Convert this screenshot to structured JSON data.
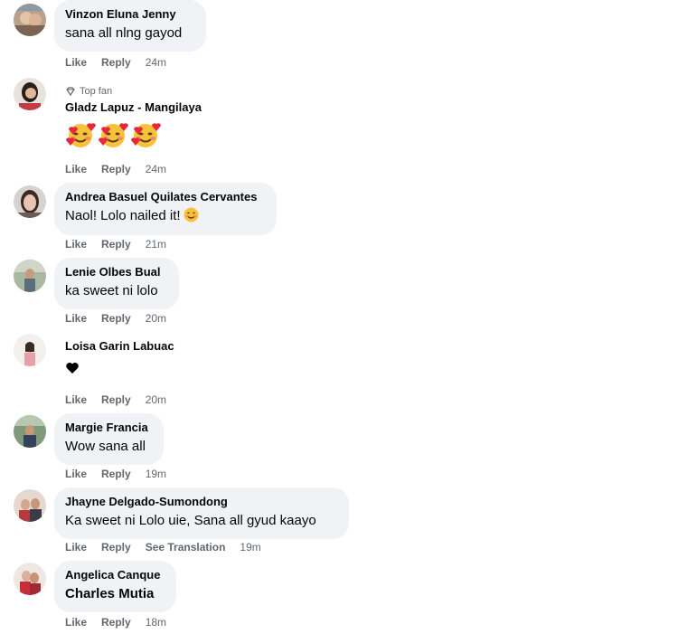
{
  "comments": [
    {
      "author": "Vinzon Eluna Jenny",
      "text": "sana all nlng gayod",
      "like": "Like",
      "reply": "Reply",
      "time": "24m"
    },
    {
      "badge": "Top fan",
      "author": "Gladz Lapuz - Mangilaya",
      "like": "Like",
      "reply": "Reply",
      "time": "24m",
      "emoji": "smiling-face-with-hearts",
      "emoji_count": 3
    },
    {
      "author": "Andrea Basuel Quilates Cervantes",
      "text": "Naol! Lolo nailed it!",
      "emoji": "smiling-face",
      "like": "Like",
      "reply": "Reply",
      "time": "21m"
    },
    {
      "author": "Lenie Olbes Bual",
      "text": "ka sweet ni lolo",
      "like": "Like",
      "reply": "Reply",
      "time": "20m"
    },
    {
      "author": "Loisa Garin Labuac",
      "emoji": "black-heart",
      "like": "Like",
      "reply": "Reply",
      "time": "20m"
    },
    {
      "author": "Margie Francia",
      "text": "Wow sana all",
      "like": "Like",
      "reply": "Reply",
      "time": "19m"
    },
    {
      "author": "Jhayne Delgado-Sumondong",
      "text": "Ka sweet ni Lolo uie, Sana all gyud kaayo",
      "like": "Like",
      "reply": "Reply",
      "see_translation": "See Translation",
      "time": "19m"
    },
    {
      "author": "Angelica Canque",
      "text": "Charles Mutia",
      "like": "Like",
      "reply": "Reply",
      "time": "18m"
    }
  ]
}
